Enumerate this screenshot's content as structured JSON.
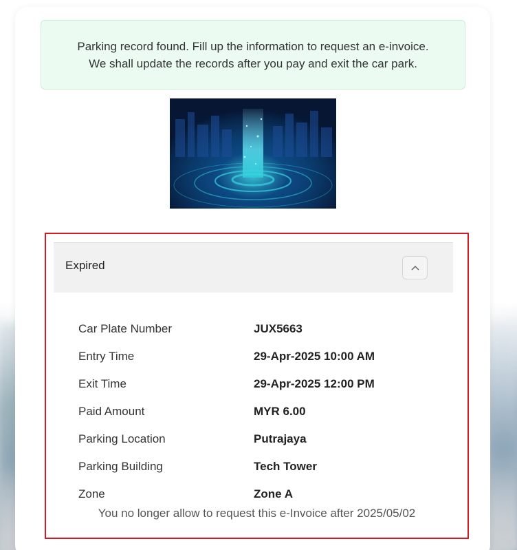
{
  "alert": {
    "line1": "Parking record found. Fill up the information to request an e-invoice.",
    "line2": "We shall update the records after you pay and exit the car park."
  },
  "panel": {
    "title": "Expired",
    "toggle_icon": "chevron-up-icon"
  },
  "details": [
    {
      "label": "Car Plate Number",
      "value": "JUX5663"
    },
    {
      "label": "Entry Time",
      "value": "29-Apr-2025 10:00 AM"
    },
    {
      "label": "Exit Time",
      "value": "29-Apr-2025 12:00 PM"
    },
    {
      "label": "Paid Amount",
      "value": "MYR 6.00"
    },
    {
      "label": "Parking Location",
      "value": "Putrajaya"
    },
    {
      "label": "Parking Building",
      "value": "Tech Tower"
    },
    {
      "label": "Zone",
      "value": "Zone A"
    }
  ],
  "note": "You no longer allow to request this e-Invoice after 2025/05/02",
  "colors": {
    "alert_bg": "#ebfbf1",
    "highlight_border": "#d01a26",
    "panel_header_bg": "#f1f1f1"
  }
}
